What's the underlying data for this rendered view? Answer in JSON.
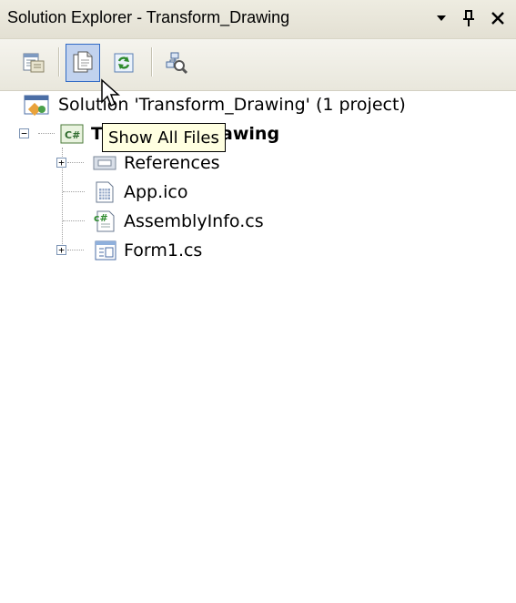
{
  "window": {
    "title": "Solution Explorer - Transform_Drawing",
    "buttons": {
      "dropdown_icon": "triangle-down",
      "pin_icon": "pin",
      "close_icon": "close"
    }
  },
  "toolbar": {
    "buttons": [
      {
        "name": "Properties",
        "icon": "properties-icon",
        "pressed": false
      },
      {
        "name": "Show All Files",
        "icon": "show-all-files-icon",
        "pressed": true
      },
      {
        "name": "Refresh",
        "icon": "refresh-icon",
        "pressed": false
      },
      {
        "name": "View Class Diagram",
        "icon": "class-diagram-icon",
        "pressed": false
      }
    ]
  },
  "tooltip": {
    "text": "Show All Files"
  },
  "tree": {
    "solution": "Solution 'Transform_Drawing' (1 project)",
    "project": "Transform_Drawing",
    "items": [
      {
        "label": "References",
        "icon": "references-icon",
        "expandable": true
      },
      {
        "label": "App.ico",
        "icon": "icon-file-icon",
        "expandable": false
      },
      {
        "label": "AssemblyInfo.cs",
        "icon": "csharp-file-icon",
        "expandable": false
      },
      {
        "label": "Form1.cs",
        "icon": "form-icon",
        "expandable": true
      }
    ]
  },
  "colors": {
    "titlebar": "#e3e0d3",
    "pressed_button": "#c1d2ee",
    "tooltip_bg": "#ffffe1",
    "accent": "#316ac5"
  }
}
